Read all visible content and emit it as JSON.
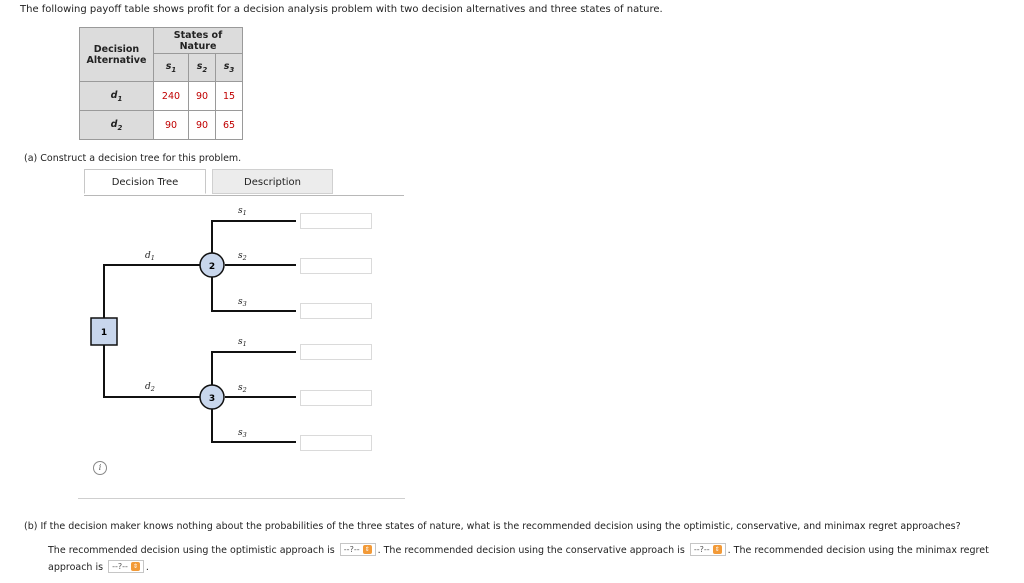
{
  "intro": "The following payoff table shows profit for a decision analysis problem with two decision alternatives and three states of nature.",
  "table": {
    "decision_header_line1": "Decision",
    "decision_header_line2": "Alternative",
    "states_header": "States of Nature",
    "states": [
      {
        "sym": "s",
        "sub": "1"
      },
      {
        "sym": "s",
        "sub": "2"
      },
      {
        "sym": "s",
        "sub": "3"
      }
    ],
    "rows": [
      {
        "sym": "d",
        "sub": "1",
        "values": [
          "240",
          "90",
          "15"
        ]
      },
      {
        "sym": "d",
        "sub": "2",
        "values": [
          "90",
          "90",
          "65"
        ]
      }
    ]
  },
  "part_a": "(a)   Construct a decision tree for this problem.",
  "tabs": [
    "Decision Tree",
    "Description"
  ],
  "tree": {
    "node1": "1",
    "node2": "2",
    "node3": "3",
    "branch_d1": {
      "sym": "d",
      "sub": "1"
    },
    "branch_d2": {
      "sym": "d",
      "sub": "2"
    },
    "node2_branches": [
      {
        "sym": "s",
        "sub": "1"
      },
      {
        "sym": "s",
        "sub": "2"
      },
      {
        "sym": "s",
        "sub": "3"
      }
    ],
    "node3_branches": [
      {
        "sym": "s",
        "sub": "1"
      },
      {
        "sym": "s",
        "sub": "2"
      },
      {
        "sym": "s",
        "sub": "3"
      }
    ]
  },
  "info_icon": "i",
  "part_b": "(b)   If the decision maker knows nothing about the probabilities of the three states of nature, what is the recommended decision using the optimistic, conservative, and minimax regret approaches?",
  "answers": {
    "optimistic_text": "The recommended decision using the optimistic approach is",
    "conservative_text": ". The recommended decision using the conservative approach is",
    "minimax_text": ". The recommended decision using the minimax regret approach is",
    "select_placeholder": "--?--",
    "end": "."
  },
  "colors": {
    "values": "#c00000",
    "node_fill": "#c8d6ec",
    "header_bg": "#dcdcdc",
    "select_arrow": "#f29a38"
  }
}
